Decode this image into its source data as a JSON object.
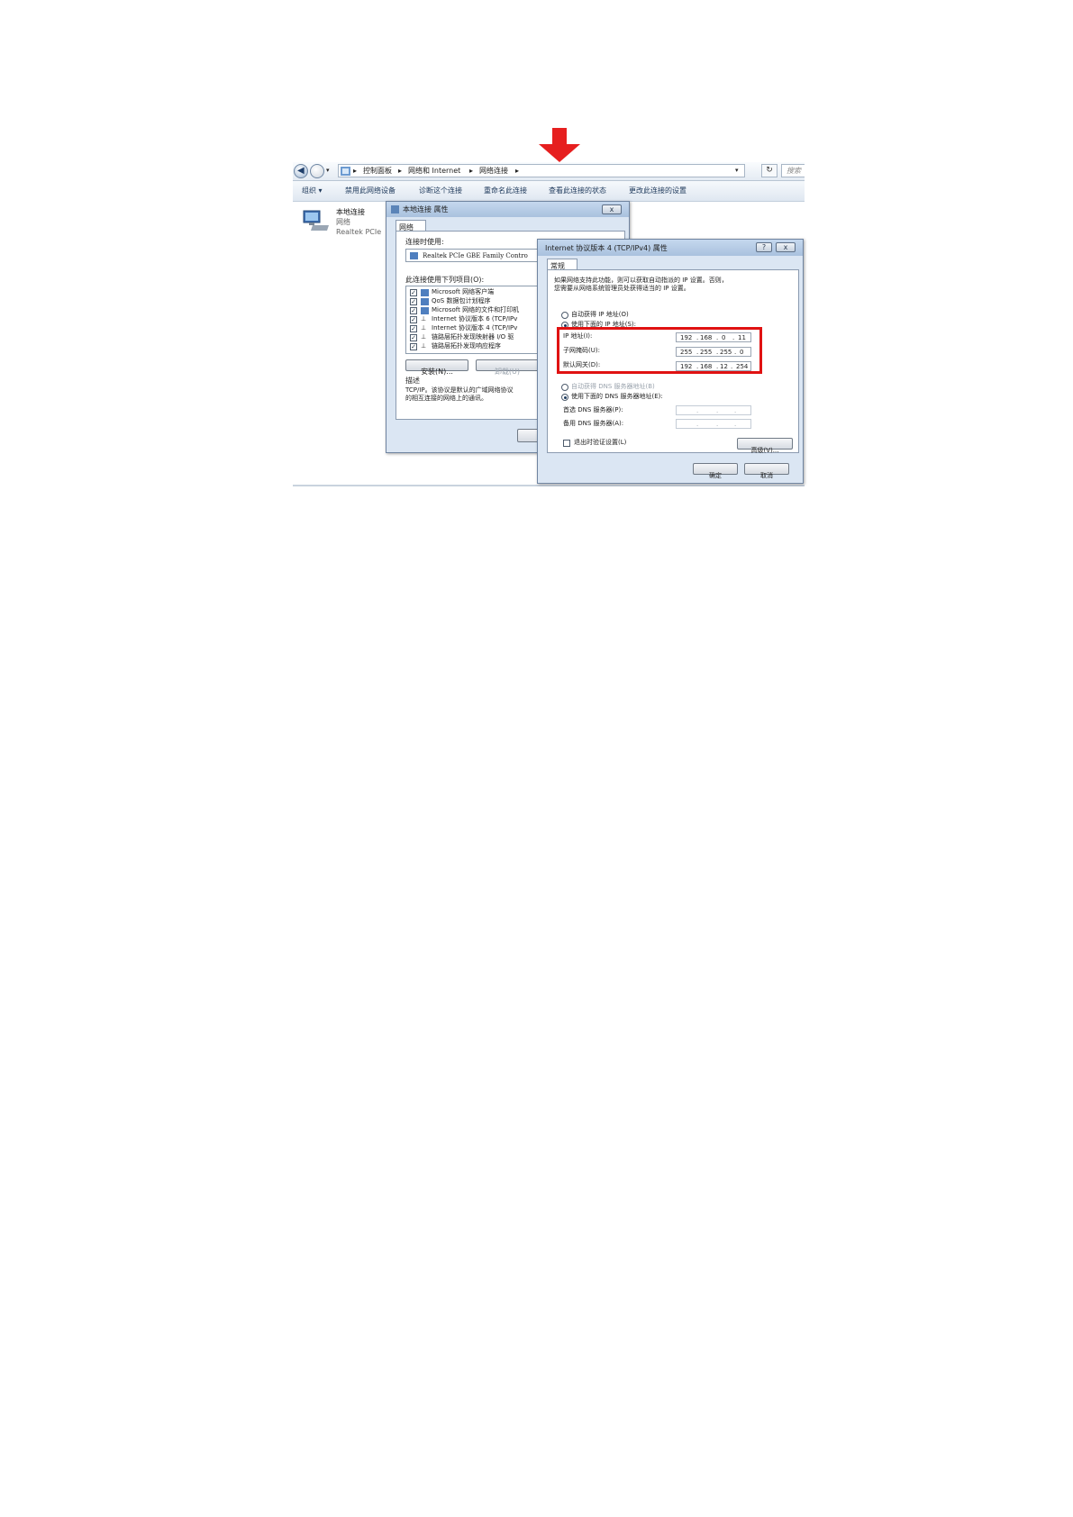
{
  "window": {
    "breadcrumb": [
      "控制面板",
      "网络和 Internet",
      "网络连接"
    ],
    "search_placeholder": "搜索"
  },
  "toolbar": {
    "items": [
      "组织 ▾",
      "禁用此网络设备",
      "诊断这个连接",
      "重命名此连接",
      "查看此连接的状态",
      "更改此连接的设置"
    ]
  },
  "connection": {
    "name": "本地连接",
    "network": "网络",
    "adapter": "Realtek PCIe"
  },
  "properties_dialog": {
    "title": "本地连接 属性",
    "tab": "网络",
    "connect_using_label": "连接时使用:",
    "adapter": "Realtek PCIe GBE Family Contro",
    "items_label": "此连接使用下列项目(O):",
    "items": [
      "Microsoft 网络客户端",
      "QoS 数据包计划程序",
      "Microsoft 网络的文件和打印机",
      "Internet 协议版本 6 (TCP/IPv",
      "Internet 协议版本 4 (TCP/IPv",
      "链路层拓扑发现映射器 I/O 驱",
      "链路层拓扑发现响应程序"
    ],
    "install_button": "安装(N)...",
    "uninstall_button": "卸载(U)",
    "description_label": "描述",
    "description_text": [
      "TCP/IP。该协议是默认的广域网络协议",
      "的相互连接的网络上的通讯。"
    ],
    "ok_button_partial": "确"
  },
  "ipv4_dialog": {
    "title": "Internet 协议版本 4 (TCP/IPv4) 属性",
    "help_button": "?",
    "close_button": "x",
    "tab": "常规",
    "intro": [
      "如果网络支持此功能，则可以获取自动指派的 IP 设置。否则，",
      "您需要从网络系统管理员处获得适当的 IP 设置。"
    ],
    "auto_ip_label": "自动获得 IP 地址(O)",
    "manual_ip_label": "使用下面的 IP 地址(S):",
    "ip_label": "IP 地址(I):",
    "ip_value": [
      "192",
      "168",
      "0",
      "11"
    ],
    "mask_label": "子网掩码(U):",
    "mask_value": [
      "255",
      "255",
      "255",
      "0"
    ],
    "gateway_label": "默认网关(D):",
    "gateway_value": [
      "192",
      "168",
      "12",
      "254"
    ],
    "auto_dns_label": "自动获得 DNS 服务器地址(B)",
    "manual_dns_label": "使用下面的 DNS 服务器地址(E):",
    "dns1_label": "首选 DNS 服务器(P):",
    "dns2_label": "备用 DNS 服务器(A):",
    "validate_label": "退出时验证设置(L)",
    "advanced_button": "高级(V)...",
    "ok_button": "确定",
    "cancel_button": "取消"
  },
  "colors": {
    "arrow": "#e61f1f",
    "highlight_box": "#e01212"
  }
}
